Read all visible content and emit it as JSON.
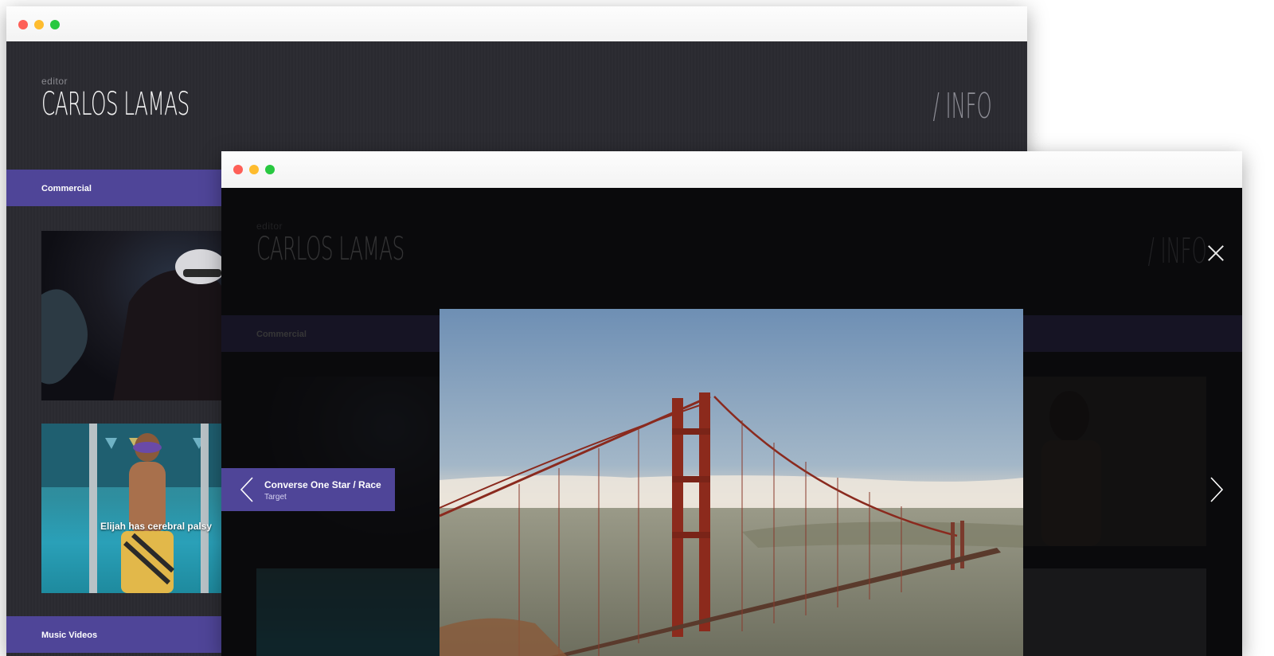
{
  "site": {
    "role_label": "editor",
    "name": "CARLOS LAMAS",
    "info_label": "/ INFO"
  },
  "back_window": {
    "categories": [
      {
        "label": "Commercial"
      },
      {
        "label": "Music Videos"
      }
    ],
    "thumbnails": [
      {
        "caption": ""
      },
      {
        "caption": "Elijah has cerebral palsy"
      }
    ]
  },
  "lightbox": {
    "title": "Converse One Star / Race",
    "client": "Target",
    "icons": {
      "close": "close-icon",
      "prev": "chevron-left-icon",
      "next": "chevron-right-icon"
    }
  },
  "colors": {
    "accent": "#4f4598",
    "background_dark": "#2a2a2f",
    "window_bar": "#f7f7f7"
  }
}
